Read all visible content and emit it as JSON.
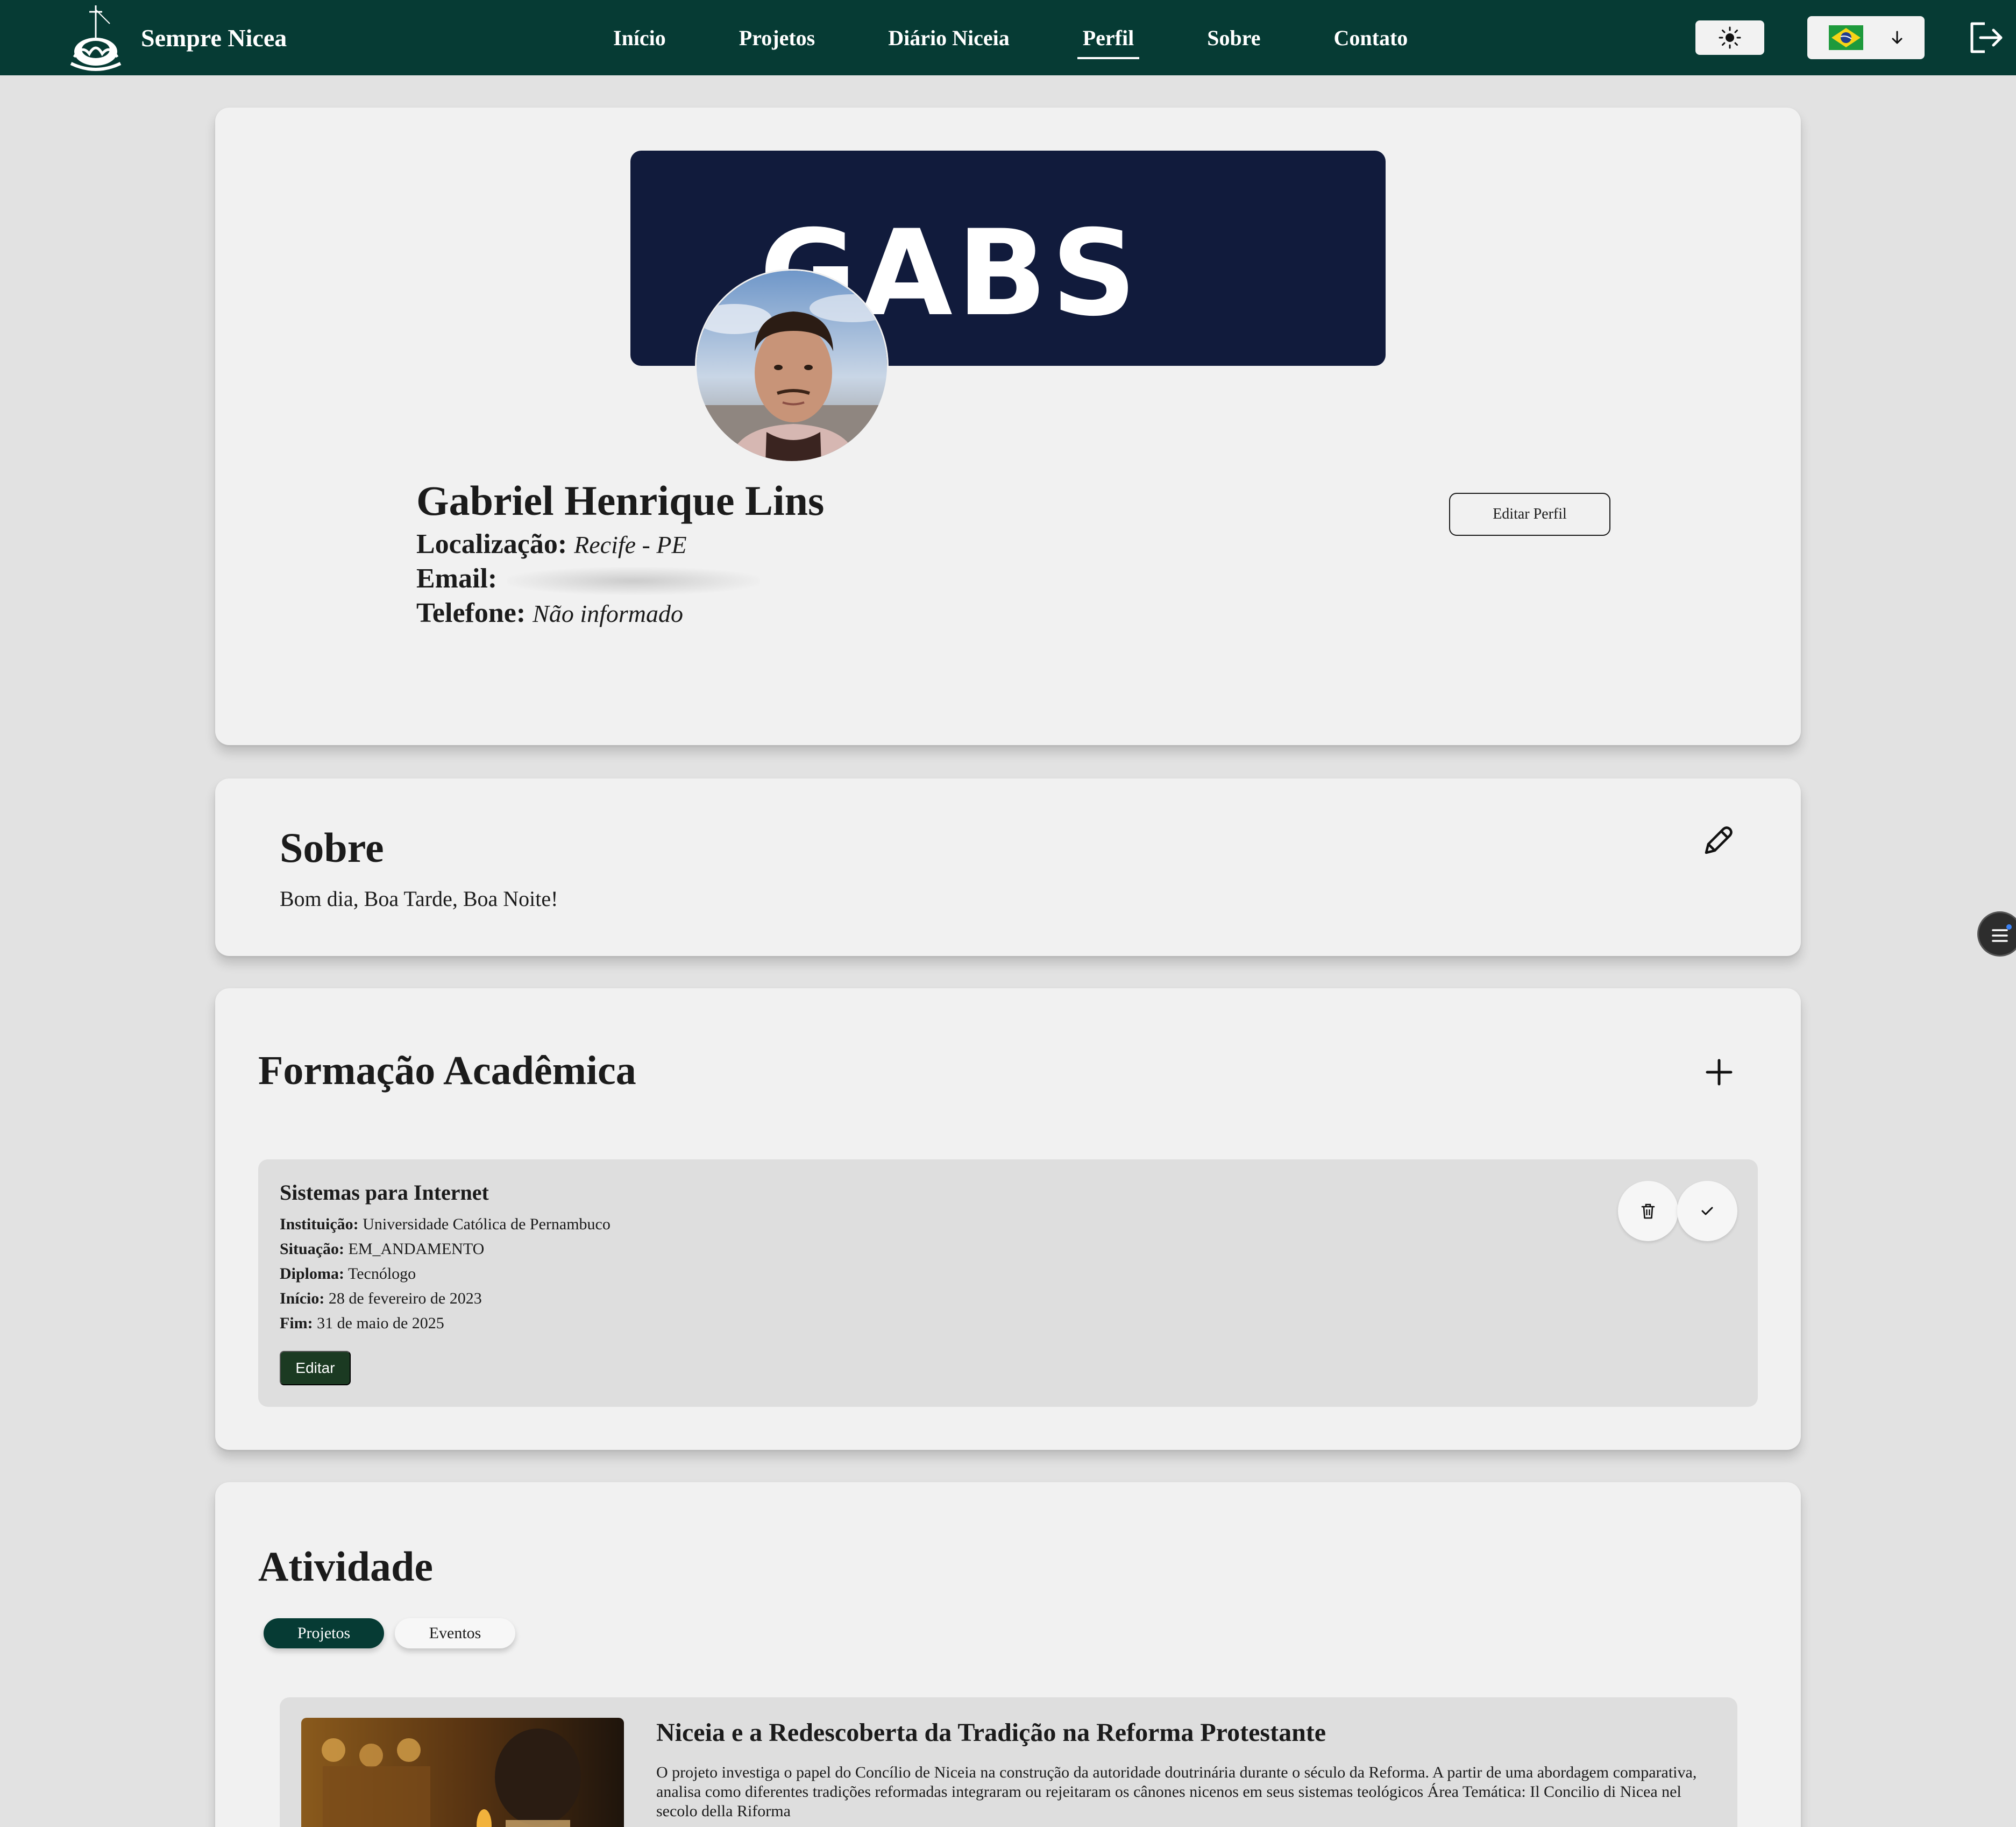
{
  "navbar": {
    "brand_name": "Sempre Nicea",
    "links": [
      {
        "label": "Início",
        "active": false
      },
      {
        "label": "Projetos",
        "active": false
      },
      {
        "label": "Diário Niceia",
        "active": false
      },
      {
        "label": "Perfil",
        "active": true
      },
      {
        "label": "Sobre",
        "active": false
      },
      {
        "label": "Contato",
        "active": false
      }
    ],
    "theme_icon": "sun-icon",
    "language_flag": "brazil-flag-icon",
    "logout_icon": "logout-icon",
    "accent_color": "#063b34"
  },
  "profile": {
    "banner_text": "GABS",
    "name": "Gabriel Henrique Lins",
    "location_label": "Localização:",
    "location_value": "Recife - PE",
    "email_label": "Email:",
    "phone_label": "Telefone:",
    "phone_value": "Não informado",
    "edit_button": "Editar Perfil"
  },
  "about": {
    "title": "Sobre",
    "text": "Bom dia, Boa Tarde, Boa Noite!",
    "edit_icon": "pencil-icon"
  },
  "education": {
    "title": "Formação Acadêmica",
    "add_icon": "plus-icon",
    "items": [
      {
        "course": "Sistemas para Internet",
        "institution_label": "Instituição:",
        "institution": "Universidade Católica de Pernambuco",
        "status_label": "Situação:",
        "status": "EM_ANDAMENTO",
        "degree_label": "Diploma:",
        "degree": "Tecnólogo",
        "start_label": "Início:",
        "start": "28 de fevereiro de 2023",
        "end_label": "Fim:",
        "end": "31 de maio de 2025",
        "edit_button": "Editar"
      }
    ]
  },
  "activity": {
    "title": "Atividade",
    "tabs": [
      {
        "label": "Projetos",
        "active": true
      },
      {
        "label": "Eventos",
        "active": false
      }
    ],
    "projects": [
      {
        "title": "Niceia e a Redescoberta da Tradição na Reforma Protestante",
        "description": "O projeto investiga o papel do Concílio de Niceia na construção da autoridade doutrinária durante o século da Reforma. A partir de uma abordagem comparativa, analisa como diferentes tradições reformadas integraram ou rejeitaram os cânones nicenos em seus sistemas teológicos Área Temática: Il Concilio di Nicea nel secolo della Riforma"
      }
    ]
  }
}
